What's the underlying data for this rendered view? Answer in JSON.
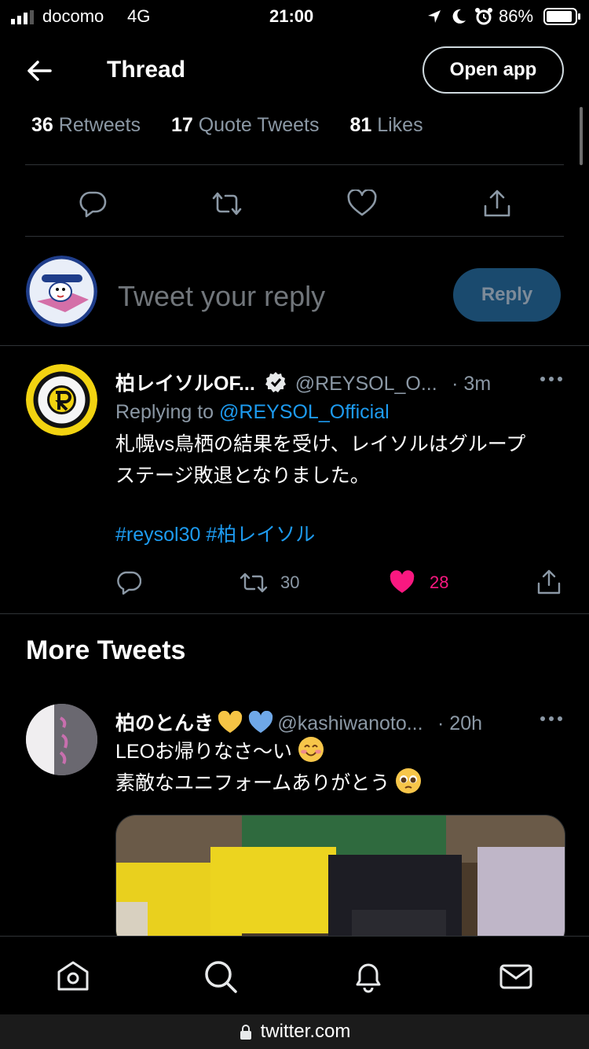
{
  "status": {
    "carrier": "docomo",
    "network": "4G",
    "time": "21:00",
    "battery": "86%"
  },
  "header": {
    "title": "Thread",
    "open_app": "Open app"
  },
  "stats": {
    "retweets_count": "36",
    "retweets_label": "Retweets",
    "quotes_count": "17",
    "quotes_label": "Quote Tweets",
    "likes_count": "81",
    "likes_label": "Likes"
  },
  "composer": {
    "placeholder": "Tweet your reply",
    "reply_label": "Reply"
  },
  "reply_tweet": {
    "name": "柏レイソルOF...",
    "handle": "@REYSOL_O...",
    "time": "· 3m",
    "replying_prefix": "Replying to",
    "replying_to": "@REYSOL_Official",
    "text_line1": "札幌vs鳥栖の結果を受け、レイソルはグループ",
    "text_line2": "ステージ敗退となりました。",
    "hashtag1": "#reysol30",
    "hashtag2": "#柏レイソル",
    "retweets": "30",
    "likes": "28"
  },
  "more_tweets": {
    "title": "More Tweets",
    "tweet": {
      "name": "柏のとんき",
      "handle": "@kashiwanoto...",
      "time": "· 20h",
      "text_line1": "LEOお帰りなさ〜い",
      "text_line2": "素敵なユニフォームありがとう"
    }
  },
  "browser": {
    "url": "twitter.com"
  },
  "colors": {
    "accent": "#1d9bf0",
    "like": "#f91880",
    "muted": "#8b98a5"
  }
}
